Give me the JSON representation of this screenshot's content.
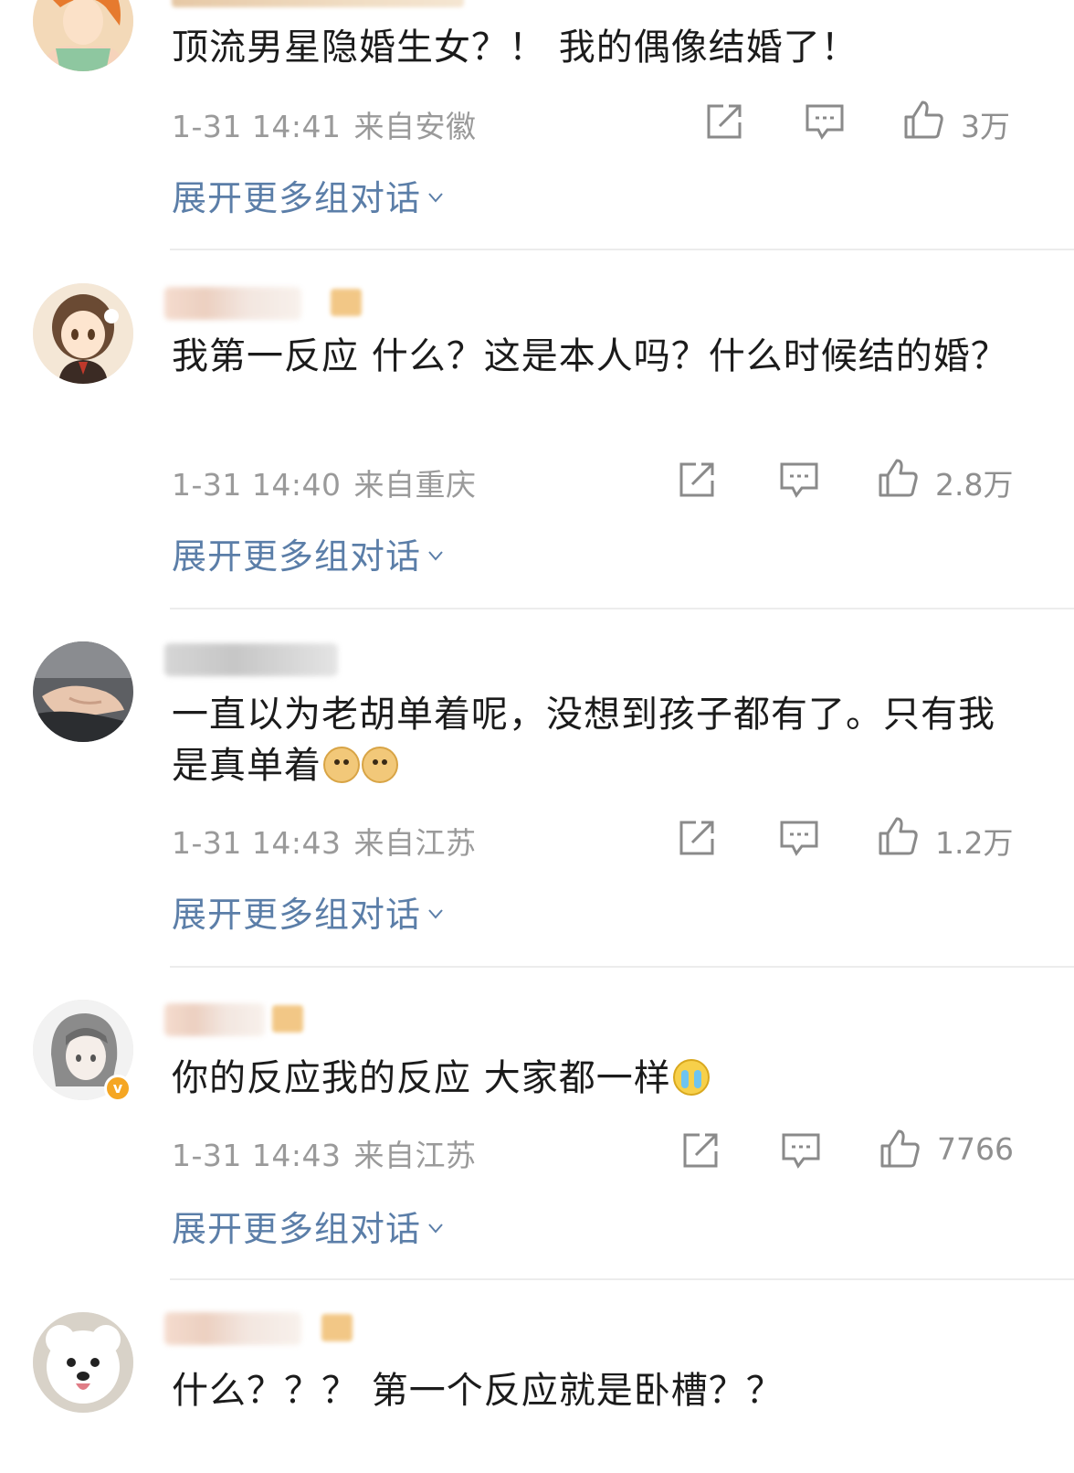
{
  "comments": [
    {
      "text": "顶流男星隐婚生女？！ 我的偶像结婚了！",
      "date": "1-31 14:41",
      "location": "来自安徽",
      "likes": "3万",
      "expand": "展开更多组对话"
    },
    {
      "text": "我第一反应 什么？这是本人吗？什么时候结的婚？",
      "date": "1-31 14:40",
      "location": "来自重庆",
      "likes": "2.8万",
      "expand": "展开更多组对话"
    },
    {
      "text": "一直以为老胡单着呢，没想到孩子都有了。只有我是真单着",
      "date": "1-31 14:43",
      "location": "来自江苏",
      "likes": "1.2万",
      "expand": "展开更多组对话"
    },
    {
      "text": "你的反应我的反应 大家都一样",
      "date": "1-31 14:43",
      "location": "来自江苏",
      "likes": "7766",
      "expand": "展开更多组对话"
    },
    {
      "text": "什么？？？ 第一个反应就是卧槽？？",
      "date": "",
      "location": "",
      "likes": "",
      "expand": ""
    }
  ],
  "icons": {
    "share": "share-icon",
    "reply": "comment-icon",
    "like": "thumbs-up-icon",
    "expand": "chevron-down-icon",
    "verified": "verified-badge-icon"
  },
  "colors": {
    "link": "#5b7ea8",
    "meta": "#9a9a9a",
    "verified": "#f5a623"
  }
}
